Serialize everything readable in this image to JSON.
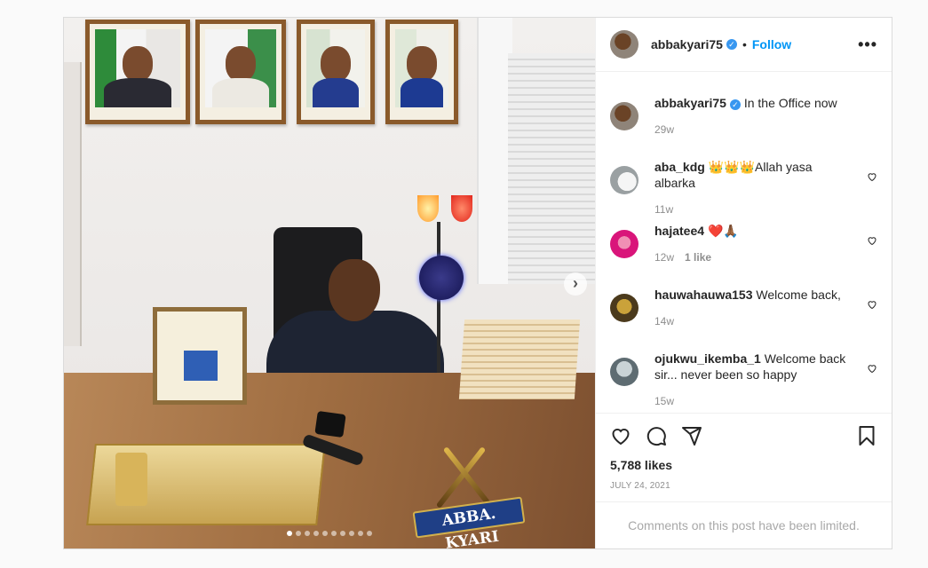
{
  "post": {
    "username": "abbakyari75",
    "follow_label": "Follow",
    "bullet": "•",
    "more_label": "•••",
    "likes": "5,788 likes",
    "date": "JULY 24, 2021",
    "limited_notice": "Comments on this post have been limited.",
    "nameplate_text": "ABBA. KYARI",
    "carousel_next": "›"
  },
  "caption": {
    "user": "abbakyari75",
    "text": "In the Office now",
    "time": "29w"
  },
  "comments": [
    {
      "user": "aba_kdg",
      "text": "👑👑👑Allah yasa albarka",
      "time": "11w",
      "likes": ""
    },
    {
      "user": "hajatee4",
      "text": "❤️🙏🏾",
      "time": "12w",
      "likes": "1 like"
    },
    {
      "user": "hauwahauwa153",
      "text": "Welcome back,",
      "time": "14w",
      "likes": ""
    },
    {
      "user": "ojukwu_ikemba_1",
      "text": "Welcome back sir... never been so happy",
      "time": "15w",
      "likes": ""
    }
  ],
  "icons": [
    "heart-icon",
    "comment-icon",
    "share-icon",
    "bookmark-icon",
    "verified-badge-icon"
  ],
  "colors": {
    "link": "#0095f6",
    "muted": "#8e8e8e",
    "verified": "#3897f0"
  },
  "carousel": {
    "slide_count": 10,
    "active_index": 0
  }
}
